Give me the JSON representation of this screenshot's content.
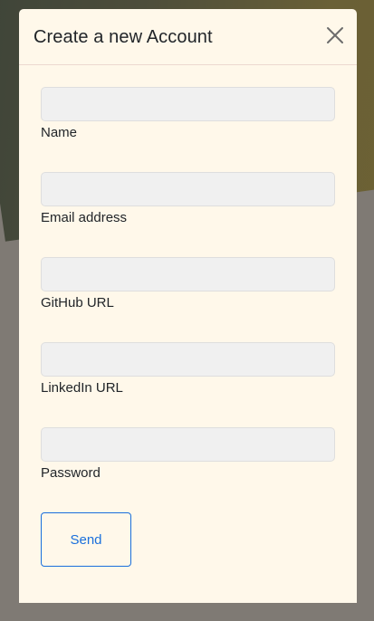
{
  "modal": {
    "title": "Create a new Account",
    "close_icon": "close-icon"
  },
  "form": {
    "fields": [
      {
        "label": "Name",
        "value": "",
        "placeholder": ""
      },
      {
        "label": "Email address",
        "value": "",
        "placeholder": ""
      },
      {
        "label": "GitHub URL",
        "value": "",
        "placeholder": ""
      },
      {
        "label": "LinkedIn URL",
        "value": "",
        "placeholder": ""
      },
      {
        "label": "Password",
        "value": "",
        "placeholder": ""
      }
    ],
    "submit_label": "Send"
  },
  "colors": {
    "modal_background": "#fff8ea",
    "input_background": "#f0f0f0",
    "accent": "#1a6fdc",
    "text": "#212529"
  }
}
